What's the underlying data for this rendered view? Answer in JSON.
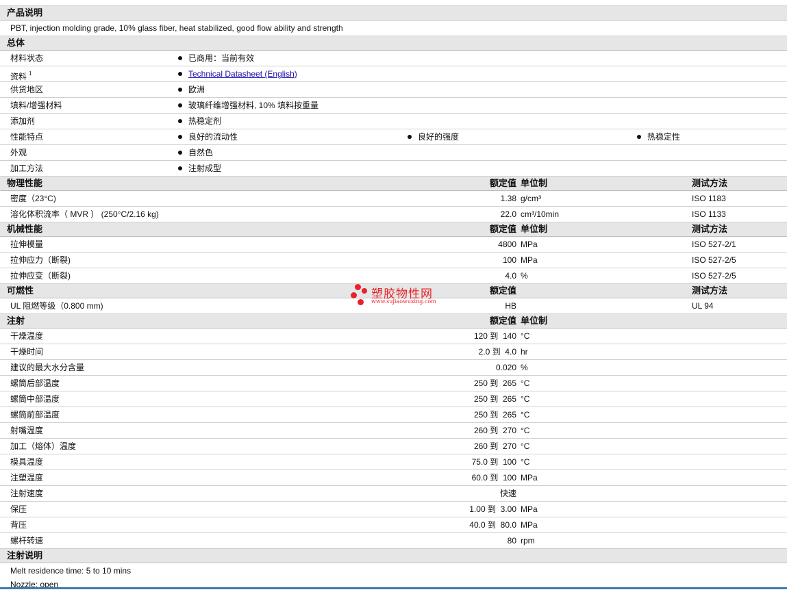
{
  "sections": [
    {
      "title": "产品说明",
      "type": "text",
      "rows": [
        {
          "label": "PBT, injection molding grade, 10% glass fiber, heat stabilized, good flow ability and strength"
        }
      ]
    },
    {
      "title": "总体",
      "type": "bullets",
      "rows": [
        {
          "label": "材料状态",
          "items": [
            "已商用：当前有效"
          ]
        },
        {
          "label": "资料",
          "sup": "1",
          "items": [
            "Technical Datasheet (English)"
          ],
          "link": true
        },
        {
          "label": "供货地区",
          "items": [
            "欧洲"
          ]
        },
        {
          "label": "填料/增强材料",
          "items": [
            "玻璃纤维增强材料, 10% 填料按重量"
          ]
        },
        {
          "label": "添加剂",
          "items": [
            "热稳定剂"
          ]
        },
        {
          "label": "性能特点",
          "items": [
            "良好的流动性",
            "良好的强度",
            "热稳定性"
          ]
        },
        {
          "label": "外观",
          "items": [
            "自然色"
          ]
        },
        {
          "label": "加工方法",
          "items": [
            "注射成型"
          ]
        }
      ]
    },
    {
      "title": "物理性能",
      "type": "props",
      "h_val": "额定值",
      "h_unit": "单位制",
      "h_test": "测试方法",
      "rows": [
        {
          "label": "密度（23°C)",
          "value": "1.38",
          "unit": "g/cm³",
          "test": "ISO 1183"
        },
        {
          "label": "溶化体积流率（ MVR ） (250°C/2.16 kg)",
          "value": "22.0",
          "unit": "cm³/10min",
          "test": "ISO 1133"
        }
      ]
    },
    {
      "title": "机械性能",
      "type": "props",
      "h_val": "额定值",
      "h_unit": "单位制",
      "h_test": "测试方法",
      "rows": [
        {
          "label": "拉伸模量",
          "value": "4800",
          "unit": "MPa",
          "test": "ISO 527-2/1"
        },
        {
          "label": "拉伸应力（断裂)",
          "value": "100",
          "unit": "MPa",
          "test": "ISO 527-2/5"
        },
        {
          "label": "拉伸应变（断裂)",
          "value": "4.0",
          "unit": "%",
          "test": "ISO 527-2/5"
        }
      ]
    },
    {
      "title": "可燃性",
      "type": "props",
      "h_val": "额定值",
      "h_test": "测试方法",
      "rows": [
        {
          "label": "UL 阻燃等级（0.800 mm)",
          "value": "HB",
          "test": "UL 94"
        }
      ]
    },
    {
      "title": "注射",
      "type": "props",
      "h_val": "额定值",
      "h_unit": "单位制",
      "rows": [
        {
          "label": "干燥温度",
          "value": "120 到  140",
          "unit": "°C"
        },
        {
          "label": "干燥时间",
          "value": "2.0 到  4.0",
          "unit": "hr"
        },
        {
          "label": "建议的最大水分含量",
          "value": "0.020",
          "unit": "%"
        },
        {
          "label": "螺筒后部温度",
          "value": "250 到  265",
          "unit": "°C"
        },
        {
          "label": "螺筒中部温度",
          "value": "250 到  265",
          "unit": "°C"
        },
        {
          "label": "螺筒前部温度",
          "value": "250 到  265",
          "unit": "°C"
        },
        {
          "label": "射嘴温度",
          "value": "260 到  270",
          "unit": "°C"
        },
        {
          "label": "加工（熔体）温度",
          "value": "260 到  270",
          "unit": "°C"
        },
        {
          "label": "模具温度",
          "value": "75.0 到  100",
          "unit": "°C"
        },
        {
          "label": "注塑温度",
          "value": "60.0 到  100",
          "unit": "MPa"
        },
        {
          "label": "注射速度",
          "value": "快速"
        },
        {
          "label": "保压",
          "value": "1.00 到  3.00",
          "unit": "MPa"
        },
        {
          "label": "背压",
          "value": "40.0 到  80.0",
          "unit": "MPa"
        },
        {
          "label": "螺杆转速",
          "value": "80",
          "unit": "rpm"
        }
      ]
    },
    {
      "title": "注射说明",
      "type": "text",
      "rows": [
        {
          "label": "Melt residence time: 5 to 10 mins"
        },
        {
          "label": "Nozzle: open"
        }
      ]
    }
  ],
  "watermark": {
    "name": "塑胶物性网",
    "url": "www.sujiaowuxing.com"
  },
  "colors": {
    "header_bg": "#e6e6e6",
    "link": "#1a0dab",
    "footer_bar": "#3f7aaa",
    "watermark": "#e8222a"
  }
}
